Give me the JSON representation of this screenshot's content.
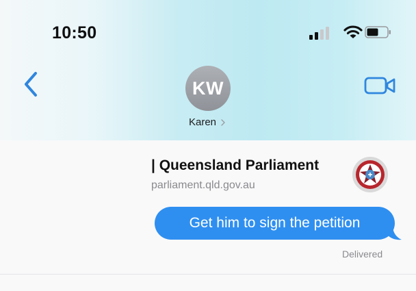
{
  "status_bar": {
    "time": "10:50",
    "icons": [
      "cellular-signal-icon",
      "wifi-icon",
      "battery-icon"
    ]
  },
  "nav": {
    "back_icon": "chevron-left-icon",
    "video_icon": "video-camera-icon"
  },
  "contact": {
    "initials": "KW",
    "name": "Karen"
  },
  "link_preview": {
    "title": "| Queensland Parliament",
    "url": "parliament.qld.gov.au",
    "icon": "parliament-crest-icon"
  },
  "message": {
    "text": "Get him to sign the petition",
    "status": "Delivered"
  },
  "colors": {
    "accent": "#2f8ff0",
    "bubble": "#2f8ff0",
    "header_tint": "#bde9f2"
  }
}
